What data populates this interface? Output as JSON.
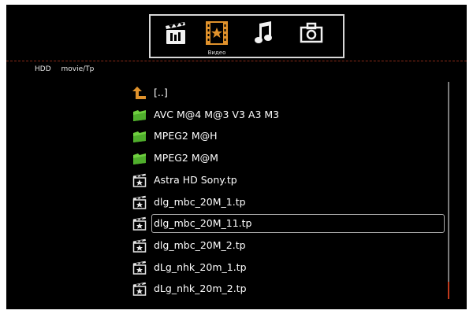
{
  "tabs": [
    {
      "id": "video",
      "icon": "video-icon",
      "label": ""
    },
    {
      "id": "film-strip",
      "icon": "film-strip-star-icon",
      "label": "Видео"
    },
    {
      "id": "music",
      "icon": "music-note-icon",
      "label": ""
    },
    {
      "id": "photo",
      "icon": "camera-icon",
      "label": ""
    }
  ],
  "active_tab": "film-strip",
  "path": {
    "device": "HDD",
    "folder": "movie/Tp"
  },
  "files": [
    {
      "type": "parent",
      "icon": "up-arrow-icon",
      "name": "[..]"
    },
    {
      "type": "folder",
      "icon": "folder-icon",
      "name": "AVC M@4 M@3 V3 A3 M3"
    },
    {
      "type": "folder",
      "icon": "folder-icon",
      "name": "MPEG2 M@H"
    },
    {
      "type": "folder",
      "icon": "folder-icon",
      "name": "MPEG2 M@M"
    },
    {
      "type": "video",
      "icon": "video-file-icon",
      "name": "Astra HD Sony.tp"
    },
    {
      "type": "video",
      "icon": "video-file-icon",
      "name": "dlg_mbc_20M_1.tp"
    },
    {
      "type": "video",
      "icon": "video-file-icon",
      "name": "dlg_mbc_20M_11.tp"
    },
    {
      "type": "video",
      "icon": "video-file-icon",
      "name": "dlg_mbc_20M_2.tp"
    },
    {
      "type": "video",
      "icon": "video-file-icon",
      "name": "dLg_nhk_20m_1.tp"
    },
    {
      "type": "video",
      "icon": "video-file-icon",
      "name": "dLg_nhk_20m_2.tp"
    }
  ],
  "selected_index": 6,
  "colors": {
    "background": "#000000",
    "accent_divider": "#8a2a18",
    "folder": "#6fcf3f",
    "parent_arrow": "#e0922c",
    "scroll_thumb": "#c0391c"
  }
}
